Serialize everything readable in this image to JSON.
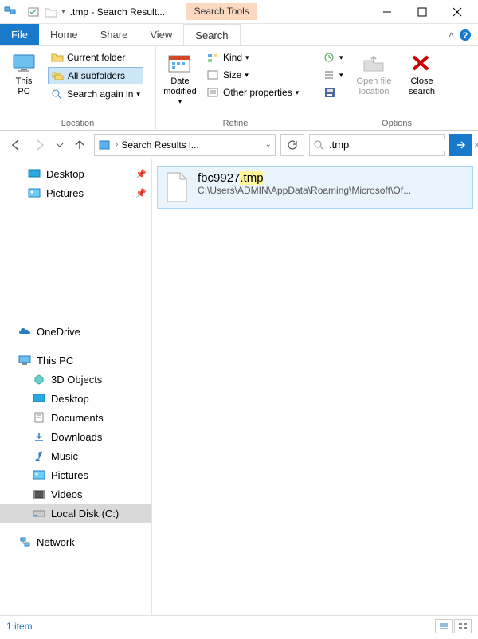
{
  "titlebar": {
    "title": ".tmp - Search Result...",
    "search_tools_label": "Search Tools"
  },
  "tabs": {
    "file": "File",
    "home": "Home",
    "share": "Share",
    "view": "View",
    "search": "Search"
  },
  "ribbon": {
    "location": {
      "this_pc": "This\nPC",
      "current_folder": "Current folder",
      "all_subfolders": "All subfolders",
      "search_again": "Search again in",
      "group_label": "Location"
    },
    "refine": {
      "date_modified": "Date\nmodified",
      "kind": "Kind",
      "size": "Size",
      "other_props": "Other properties",
      "group_label": "Refine"
    },
    "options": {
      "recent": "Recent searches",
      "advanced": "Advanced options",
      "save": "Save search",
      "open_location": "Open file\nlocation",
      "close_search": "Close\nsearch",
      "group_label": "Options"
    }
  },
  "navbar": {
    "location_text": "Search Results i...",
    "search_query": ".tmp"
  },
  "navpane": {
    "desktop": "Desktop",
    "pictures": "Pictures",
    "onedrive": "OneDrive",
    "this_pc": "This PC",
    "objects3d": "3D Objects",
    "desktop2": "Desktop",
    "documents": "Documents",
    "downloads": "Downloads",
    "music": "Music",
    "pictures2": "Pictures",
    "videos": "Videos",
    "local_disk": "Local Disk (C:)",
    "network": "Network"
  },
  "results": {
    "item1": {
      "name_prefix": "fbc9927",
      "name_highlight": ".tmp",
      "path": "C:\\Users\\ADMIN\\AppData\\Roaming\\Microsoft\\Of..."
    }
  },
  "statusbar": {
    "count": "1 item"
  }
}
